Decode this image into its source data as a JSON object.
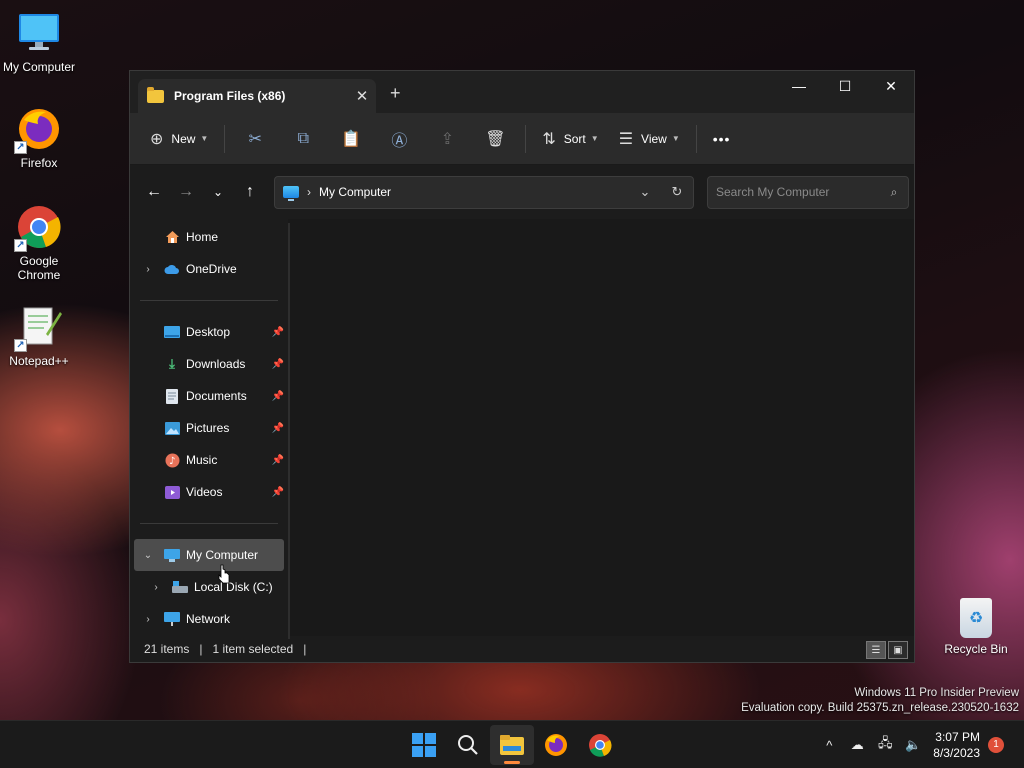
{
  "desktop": {
    "icons": [
      {
        "label": "My Computer",
        "icon": "monitor-icon"
      },
      {
        "label": "Firefox",
        "icon": "firefox-icon"
      },
      {
        "label": "Google Chrome",
        "icon": "chrome-icon"
      },
      {
        "label": "Notepad++",
        "icon": "notepadpp-icon"
      }
    ],
    "recycle_bin": "Recycle Bin",
    "watermark": {
      "line1": "Windows 11 Pro Insider Preview",
      "line2": "Evaluation copy. Build 25375.zn_release.230520-1632"
    }
  },
  "window": {
    "tab_title": "Program Files (x86)",
    "toolbar": {
      "new_label": "New",
      "sort_label": "Sort",
      "view_label": "View",
      "more_label": "•••"
    },
    "address": {
      "path": "My Computer"
    },
    "search": {
      "placeholder": "Search My Computer"
    },
    "sidebar": {
      "home": "Home",
      "onedrive": "OneDrive",
      "quick": [
        "Desktop",
        "Downloads",
        "Documents",
        "Pictures",
        "Music",
        "Videos"
      ],
      "my_computer": "My Computer",
      "local_disk": "Local Disk (C:)",
      "network": "Network"
    },
    "status": {
      "items": "21 items",
      "selected": "1 item selected"
    }
  },
  "taskbar": {
    "time": "3:07 PM",
    "date": "8/3/2023",
    "notification_count": "1"
  },
  "colors": {
    "accent": "#3aa0f3",
    "taskbar_indicator": "#ff8a3c",
    "notification": "#e0503a"
  }
}
